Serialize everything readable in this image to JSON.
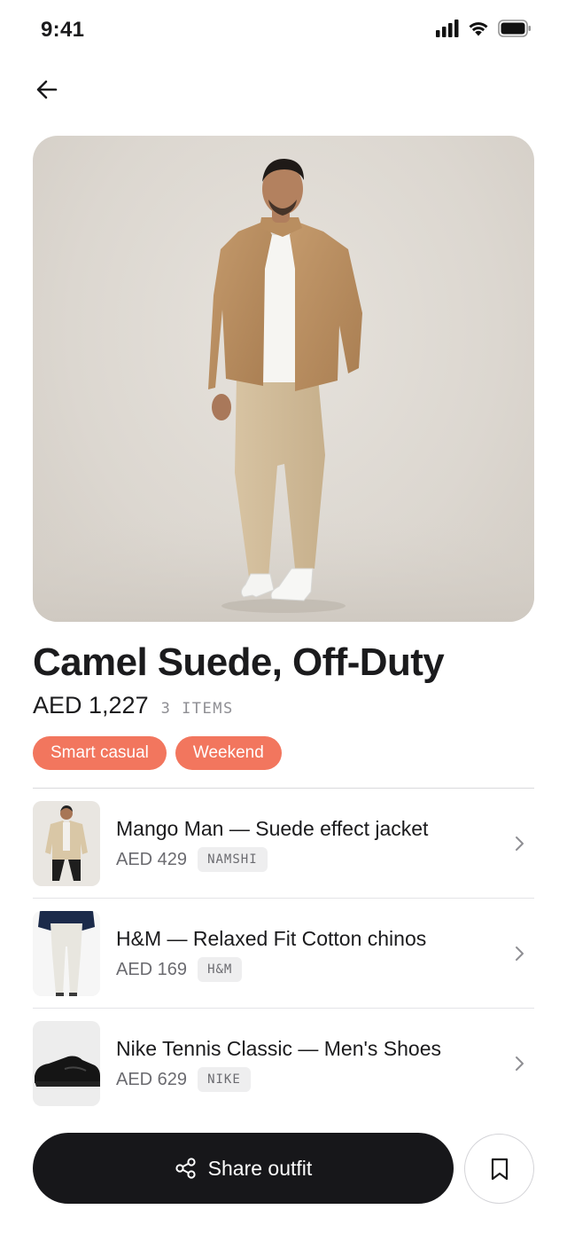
{
  "status_bar": {
    "time": "9:41"
  },
  "outfit": {
    "title": "Camel Suede, Off-Duty",
    "total_price": "AED 1,227",
    "item_count": "3 ITEMS",
    "tags": [
      "Smart casual",
      "Weekend"
    ]
  },
  "items": [
    {
      "name": "Mango Man — Suede effect jacket",
      "price": "AED 429",
      "brand": "NAMSHI"
    },
    {
      "name": "H&M — Relaxed Fit Cotton chinos",
      "price": "AED 169",
      "brand": "H&M"
    },
    {
      "name": "Nike Tennis Classic — Men's Shoes",
      "price": "AED 629",
      "brand": "NIKE"
    }
  ],
  "actions": {
    "share_label": "Share outfit"
  },
  "colors": {
    "accent": "#f2765e",
    "primary_button": "#17171a",
    "background": "#ffffff"
  },
  "icons": {
    "back": "arrow-left-icon",
    "share": "share-icon",
    "save": "bookmark-icon",
    "chevron": "chevron-right-icon"
  }
}
